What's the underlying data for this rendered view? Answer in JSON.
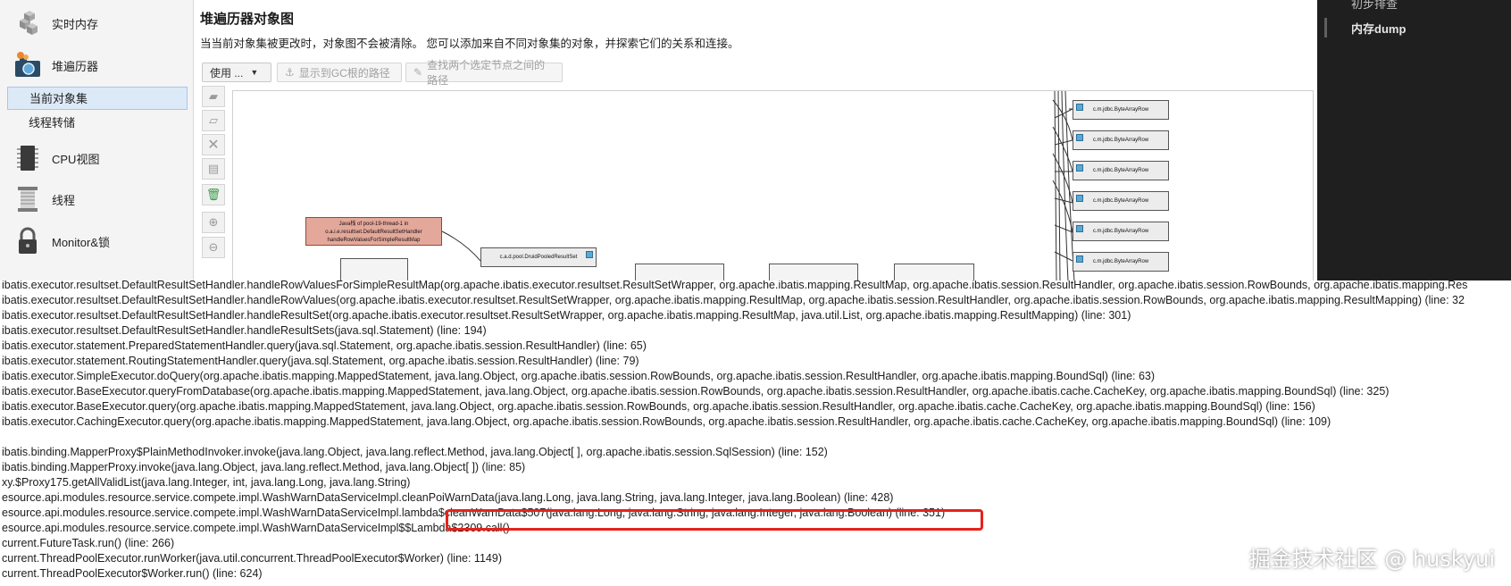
{
  "sidebar": {
    "items": [
      {
        "label": "实时内存",
        "icon": "cubes-icon"
      },
      {
        "label": "堆遍历器",
        "icon": "camera-icon"
      },
      {
        "label": "CPU视图",
        "icon": "cpu-chip-icon"
      },
      {
        "label": "线程",
        "icon": "thread-spool-icon"
      },
      {
        "label": "Monitor&锁",
        "icon": "lock-icon"
      }
    ],
    "subitems": [
      "当前对象集",
      "线程转储"
    ]
  },
  "main": {
    "title": "堆遍历器对象图",
    "description": "当当前对象集被更改时，对象图不会被清除。 您可以添加来自不同对象集的对象，并探索它们的关系和连接。",
    "toolbar": {
      "use_label": "使用 ...",
      "gc_root_label": "显示到GC根的路径",
      "path_between_label": "查找两个选定节点之间的路径"
    },
    "vertical_tools": [
      "move-node-icon",
      "remove-node-icon",
      "delete-icon",
      "layout-icon",
      "trash-icon",
      "zoom-in-icon",
      "zoom-out-icon"
    ],
    "graph": {
      "root_node_lines": [
        "Java栈 of pool-19-thread-1 in",
        "o.a.i.e.resultset.DefaultResultSetHandler",
        "handleRowValuesForSimpleResultMap"
      ],
      "pooled_node": "c.a.d.pool.DruidPooledResultSet",
      "byte_rows": [
        "c.m.jdbc.ByteArrayRow",
        "c.m.jdbc.ByteArrayRow",
        "c.m.jdbc.ByteArrayRow",
        "c.m.jdbc.ByteArrayRow",
        "c.m.jdbc.ByteArrayRow",
        "c.m.jdbc.ByteArrayRow"
      ]
    }
  },
  "right_panel": {
    "top_item": "初步排查",
    "active_item": "内存dump"
  },
  "stack_trace": [
    "ibatis.executor.resultset.DefaultResultSetHandler.handleRowValuesForSimpleResultMap(org.apache.ibatis.executor.resultset.ResultSetWrapper, org.apache.ibatis.mapping.ResultMap, org.apache.ibatis.session.ResultHandler, org.apache.ibatis.session.RowBounds, org.apache.ibatis.mapping.Res",
    "ibatis.executor.resultset.DefaultResultSetHandler.handleRowValues(org.apache.ibatis.executor.resultset.ResultSetWrapper, org.apache.ibatis.mapping.ResultMap, org.apache.ibatis.session.ResultHandler, org.apache.ibatis.session.RowBounds, org.apache.ibatis.mapping.ResultMapping) (line: 32",
    "ibatis.executor.resultset.DefaultResultSetHandler.handleResultSet(org.apache.ibatis.executor.resultset.ResultSetWrapper, org.apache.ibatis.mapping.ResultMap, java.util.List, org.apache.ibatis.mapping.ResultMapping) (line: 301)",
    "ibatis.executor.resultset.DefaultResultSetHandler.handleResultSets(java.sql.Statement) (line: 194)",
    "ibatis.executor.statement.PreparedStatementHandler.query(java.sql.Statement, org.apache.ibatis.session.ResultHandler) (line: 65)",
    "ibatis.executor.statement.RoutingStatementHandler.query(java.sql.Statement, org.apache.ibatis.session.ResultHandler) (line: 79)",
    "ibatis.executor.SimpleExecutor.doQuery(org.apache.ibatis.mapping.MappedStatement, java.lang.Object, org.apache.ibatis.session.RowBounds, org.apache.ibatis.session.ResultHandler, org.apache.ibatis.mapping.BoundSql) (line: 63)",
    "ibatis.executor.BaseExecutor.queryFromDatabase(org.apache.ibatis.mapping.MappedStatement, java.lang.Object, org.apache.ibatis.session.RowBounds, org.apache.ibatis.session.ResultHandler, org.apache.ibatis.cache.CacheKey, org.apache.ibatis.mapping.BoundSql) (line: 325)",
    "ibatis.executor.BaseExecutor.query(org.apache.ibatis.mapping.MappedStatement, java.lang.Object, org.apache.ibatis.session.RowBounds, org.apache.ibatis.session.ResultHandler, org.apache.ibatis.cache.CacheKey, org.apache.ibatis.mapping.BoundSql) (line: 156)",
    "ibatis.executor.CachingExecutor.query(org.apache.ibatis.mapping.MappedStatement, java.lang.Object, org.apache.ibatis.session.RowBounds, org.apache.ibatis.session.ResultHandler, org.apache.ibatis.cache.CacheKey, org.apache.ibatis.mapping.BoundSql) (line: 109)",
    "",
    "ibatis.binding.MapperProxy$PlainMethodInvoker.invoke(java.lang.Object, java.lang.reflect.Method, java.lang.Object[ ], org.apache.ibatis.session.SqlSession) (line: 152)",
    "ibatis.binding.MapperProxy.invoke(java.lang.Object, java.lang.reflect.Method, java.lang.Object[ ]) (line: 85)",
    "xy.$Proxy175.getAllValidList(java.lang.Integer, int, java.lang.Long, java.lang.String)",
    "esource.api.modules.resource.service.compete.impl.WashWarnDataServiceImpl.cleanPoiWarnData(java.lang.Long, java.lang.String, java.lang.Integer, java.lang.Boolean) (line: 428)",
    "esource.api.modules.resource.service.compete.impl.WashWarnDataServiceImpl.lambda$cleanWarnData$507(java.lang.Long, java.lang.String, java.lang.Integer, java.lang.Boolean) (line: 351)",
    "esource.api.modules.resource.service.compete.impl.WashWarnDataServiceImpl$$Lambda$2309.call()",
    "current.FutureTask.run() (line: 266)",
    "current.ThreadPoolExecutor.runWorker(java.util.concurrent.ThreadPoolExecutor$Worker) (line: 1149)",
    "current.ThreadPoolExecutor$Worker.run() (line: 624)"
  ],
  "watermark": "掘金技术社区 @ huskyui",
  "colors": {
    "highlight": "#e5231c",
    "selected_bg": "#dce9f7",
    "root_node": "#e4a89a",
    "dark_panel": "#1f1f1f"
  }
}
